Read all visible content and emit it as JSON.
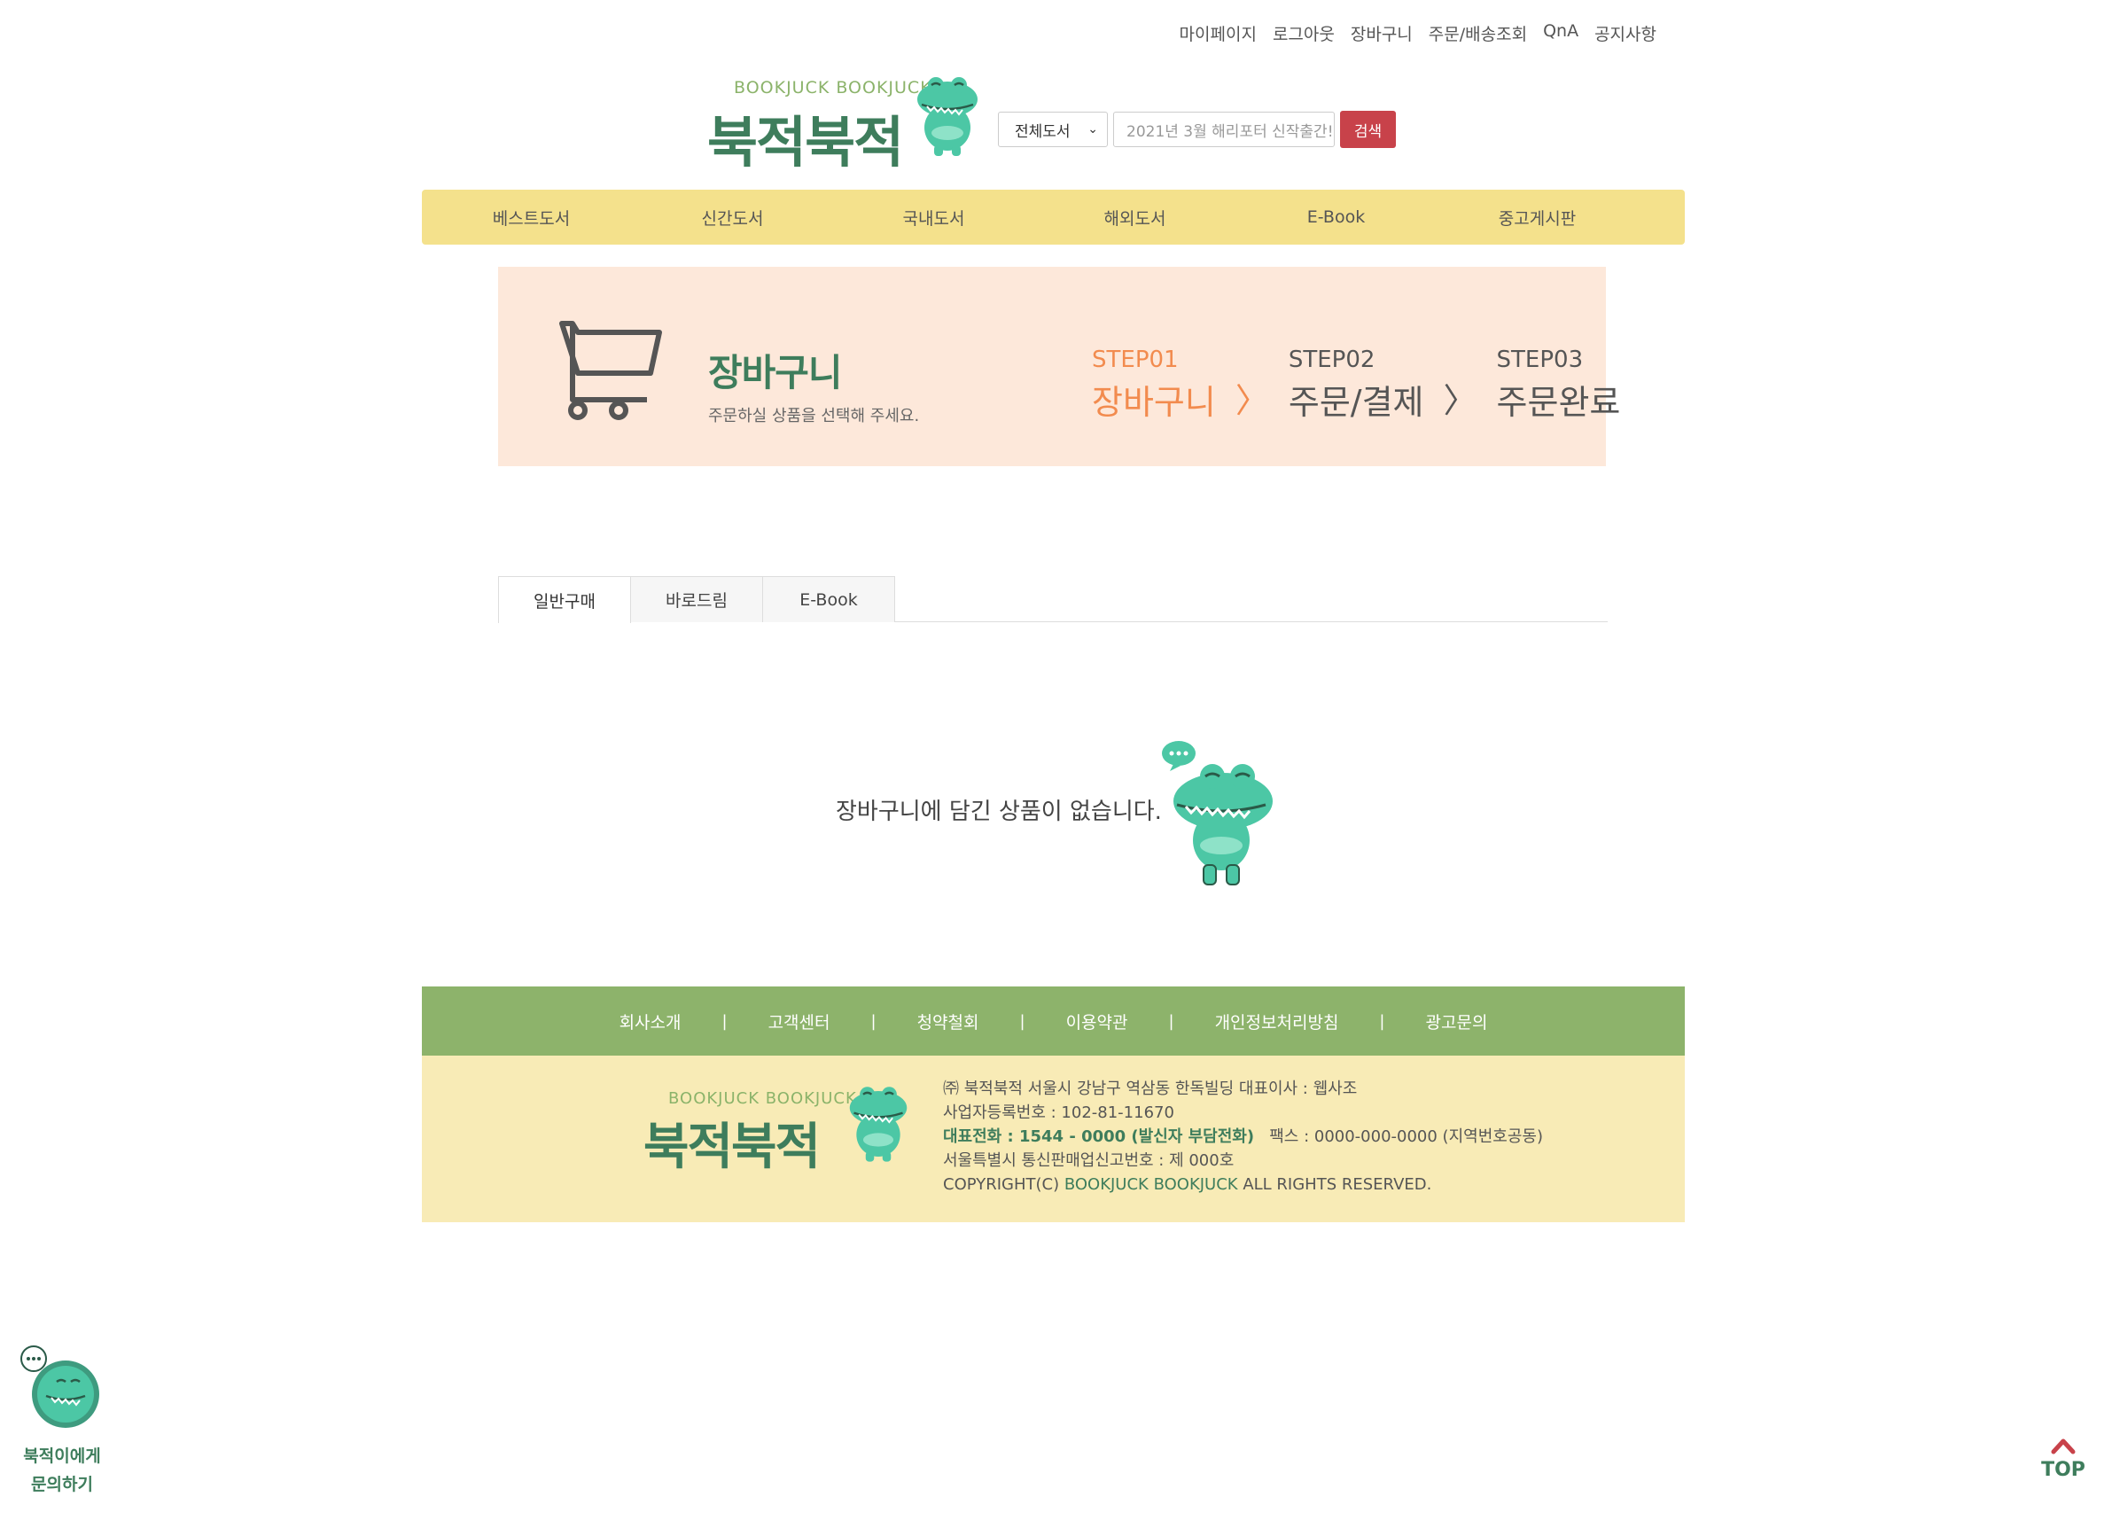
{
  "utility_links": [
    "마이페이지",
    "로그아웃",
    "장바구니",
    "주문/배송조회",
    "QnA",
    "공지사항"
  ],
  "logo": {
    "sub": "BOOKJUCK BOOKJUCK",
    "main": "북적북적"
  },
  "search": {
    "category": "전체도서",
    "placeholder": "2021년 3월 해리포터 신작출간!",
    "button": "검색"
  },
  "nav": [
    "베스트도서",
    "신간도서",
    "국내도서",
    "해외도서",
    "E-Book",
    "중고게시판"
  ],
  "banner": {
    "title": "장바구니",
    "subtitle": "주문하실 상품을 선택해 주세요.",
    "steps": [
      {
        "num": "STEP01",
        "label": "장바구니"
      },
      {
        "num": "STEP02",
        "label": "주문/결제"
      },
      {
        "num": "STEP03",
        "label": "주문완료"
      }
    ],
    "separator": "〉"
  },
  "tabs": [
    "일반구매",
    "바로드림",
    "E-Book"
  ],
  "empty_message": "장바구니에 담긴 상품이 없습니다.",
  "footer": {
    "links": [
      "회사소개",
      "고객센터",
      "청약철회",
      "이용약관",
      "개인정보처리방침",
      "광고문의"
    ],
    "separator": "|",
    "line1": "㈜ 북적북적   서울시 강남구 역삼동 한독빌딩   대표이사 : 웹사조",
    "line2": "사업자등록번호 : 102-81-11670",
    "line3_highlight": "대표전화 : 1544 - 0000 (발신자 부담전화)",
    "line3_rest": "   팩스 : 0000-000-0000 (지역번호공동)",
    "line4": "서울특별시 통신판매업신고번호 : 제 000호",
    "line5_pre": "COPYRIGHT(C) ",
    "line5_brand": "BOOKJUCK BOOKJUCK",
    "line5_post": " ALL RIGHTS RESERVED."
  },
  "floating": {
    "ask_line1": "북적이에게",
    "ask_line2": "문의하기",
    "top": "TOP"
  },
  "colors": {
    "brand_green": "#3e7d5c",
    "nav_yellow": "#f4e18c",
    "search_red": "#c8424a",
    "step_orange": "#f28b4e",
    "footer_green": "#8db36b",
    "footer_yellow": "#f8ebb6",
    "banner_peach": "#fde8da"
  }
}
